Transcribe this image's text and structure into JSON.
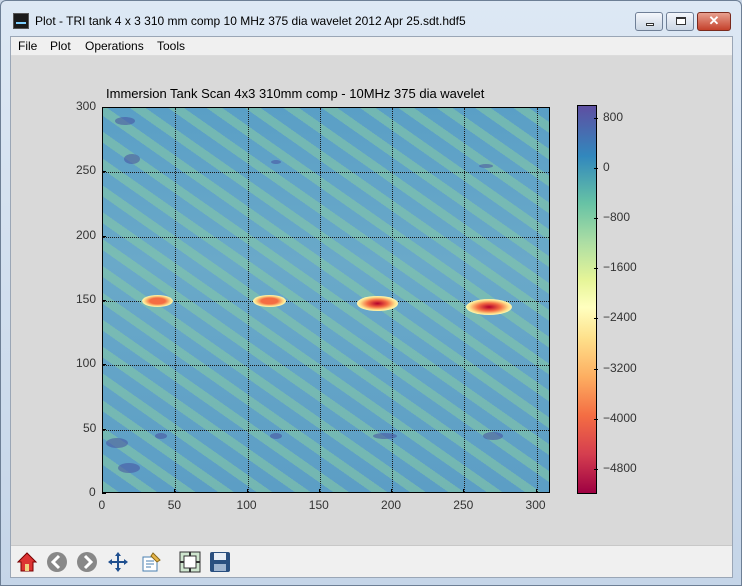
{
  "window": {
    "title": "Plot - TRI tank 4 x 3 310 mm comp 10 MHz 375 dia wavelet 2012 Apr 25.sdt.hdf5",
    "minimize_glyph": "–",
    "maximize_glyph": "□",
    "close_glyph": "✕"
  },
  "menu": {
    "items": [
      "File",
      "Plot",
      "Operations",
      "Tools"
    ]
  },
  "plot": {
    "title": "Immersion Tank Scan 4x3 310mm comp - 10MHz 375 dia wavelet",
    "x_ticks": [
      "0",
      "50",
      "100",
      "150",
      "200",
      "250",
      "300"
    ],
    "y_ticks": [
      "300",
      "250",
      "200",
      "150",
      "100",
      "50",
      "0"
    ],
    "colorbar_ticks": [
      "800",
      "0",
      "−800",
      "−1600",
      "−2400",
      "−3200",
      "−4000",
      "−4800"
    ],
    "colormap_colors": [
      "#5e4fa2",
      "#3288bd",
      "#66c2a5",
      "#abdda4",
      "#e6f598",
      "#ffffbf",
      "#fee08b",
      "#fdae61",
      "#f46d43",
      "#d53e4f",
      "#9e0142"
    ]
  },
  "chart_data": {
    "type": "heatmap",
    "title": "Immersion Tank Scan 4x3 310mm comp - 10MHz 375 dia wavelet",
    "xlabel": "",
    "ylabel": "",
    "xlim": [
      0,
      310
    ],
    "ylim": [
      0,
      300
    ],
    "grid": true,
    "colorbar_range": [
      -4800,
      800
    ],
    "background_value_approx": 0,
    "indications": [
      {
        "x": 38,
        "y": 150,
        "value_approx": -2000
      },
      {
        "x": 115,
        "y": 150,
        "value_approx": -2400
      },
      {
        "x": 190,
        "y": 148,
        "value_approx": -3800
      },
      {
        "x": 267,
        "y": 145,
        "value_approx": -4800
      }
    ]
  },
  "toolbar": {
    "tools": [
      {
        "name": "home-icon",
        "tooltip": "Home"
      },
      {
        "name": "back-icon",
        "tooltip": "Back"
      },
      {
        "name": "forward-icon",
        "tooltip": "Forward"
      },
      {
        "name": "pan-icon",
        "tooltip": "Pan"
      },
      {
        "name": "zoom-icon",
        "tooltip": "Zoom"
      },
      {
        "name": "configure-subplots-icon",
        "tooltip": "Subplots"
      },
      {
        "name": "save-icon",
        "tooltip": "Save"
      }
    ]
  }
}
